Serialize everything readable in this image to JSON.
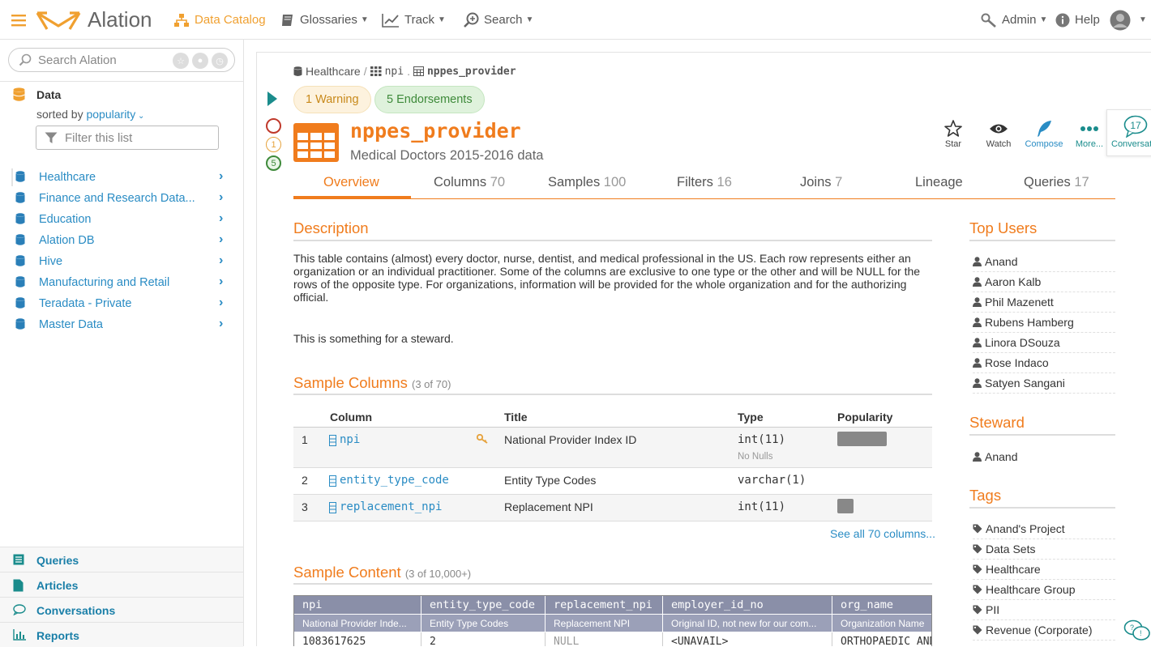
{
  "topbar": {
    "logo_text": "Alation",
    "nav": [
      {
        "label": "Data Catalog",
        "active": true
      },
      {
        "label": "Glossaries"
      },
      {
        "label": "Track"
      },
      {
        "label": "Search"
      }
    ],
    "admin_label": "Admin",
    "help_label": "Help"
  },
  "sidebar": {
    "search_placeholder": "Search Alation",
    "data_heading": "Data",
    "sorted_prefix": "sorted by",
    "sorted_value": "popularity",
    "filter_placeholder": "Filter this list",
    "sources": [
      {
        "label": "Healthcare"
      },
      {
        "label": "Finance and Research Data..."
      },
      {
        "label": "Education"
      },
      {
        "label": "Alation DB"
      },
      {
        "label": "Hive"
      },
      {
        "label": "Manufacturing and Retail"
      },
      {
        "label": "Teradata - Private"
      },
      {
        "label": "Master Data"
      }
    ],
    "bottom_nav": [
      {
        "label": "Queries"
      },
      {
        "label": "Articles"
      },
      {
        "label": "Conversations"
      },
      {
        "label": "Reports"
      }
    ]
  },
  "breadcrumb": {
    "source": "Healthcare",
    "schema": "npi",
    "table": "nppes_provider"
  },
  "badges": {
    "warning": "1 Warning",
    "endorsements": "5 Endorsements"
  },
  "status_counts": {
    "warning": "1",
    "endorsements": "5"
  },
  "object": {
    "title": "nppes_provider",
    "subtitle": "Medical Doctors 2015-2016 data"
  },
  "actions": {
    "star": "Star",
    "watch": "Watch",
    "compose": "Compose",
    "more": "More...",
    "conversation_label": "Conversation",
    "conversation_count": "17"
  },
  "tabs": [
    {
      "label": "Overview",
      "count": ""
    },
    {
      "label": "Columns",
      "count": "70"
    },
    {
      "label": "Samples",
      "count": "100"
    },
    {
      "label": "Filters",
      "count": "16"
    },
    {
      "label": "Joins",
      "count": "7"
    },
    {
      "label": "Lineage",
      "count": ""
    },
    {
      "label": "Queries",
      "count": "17"
    }
  ],
  "description": {
    "heading": "Description",
    "text": "This table contains (almost) every doctor, nurse, dentist, and medical professional in the US. Each row represents either an organization or an individual practitioner. Some of the columns are exclusive to one type or the other and will be NULL for the rows of the opposite type. For organizations, information will be provided for the whole organization and for the authorizing official.",
    "note": "This is something for a steward."
  },
  "sample_columns": {
    "heading": "Sample Columns",
    "count_label": "(3 of 70)",
    "headers": {
      "column": "Column",
      "title": "Title",
      "type": "Type",
      "popularity": "Popularity"
    },
    "rows": [
      {
        "num": "1",
        "name": "npi",
        "title": "National Provider Index ID",
        "type": "int(11)",
        "extra": "No Nulls",
        "popularity": 0.9
      },
      {
        "num": "2",
        "name": "entity_type_code",
        "title": "Entity Type Codes",
        "type": "varchar(1)",
        "extra": "",
        "popularity": 0
      },
      {
        "num": "3",
        "name": "replacement_npi",
        "title": "Replacement NPI",
        "type": "int(11)",
        "extra": "",
        "popularity": 0.3
      }
    ],
    "see_all": "See all 70 columns..."
  },
  "sample_content": {
    "heading": "Sample Content",
    "count_label": "(3 of 10,000+)",
    "columns": [
      "npi",
      "entity_type_code",
      "replacement_npi",
      "employer_id_no",
      "org_name"
    ],
    "titles": [
      "National Provider Inde...",
      "Entity Type Codes",
      "Replacement NPI",
      "Original ID, not new for our com...",
      "Organization Name"
    ],
    "first_row": [
      "1083617625",
      "2",
      "NULL",
      "<UNAVAIL>",
      "ORTHOPAEDIC AND"
    ]
  },
  "top_users": {
    "heading": "Top Users",
    "users": [
      "Anand",
      "Aaron Kalb",
      "Phil Mazenett",
      "Rubens Hamberg",
      "Linora DSouza",
      "Rose Indaco",
      "Satyen Sangani"
    ]
  },
  "steward": {
    "heading": "Steward",
    "name": "Anand"
  },
  "tags": {
    "heading": "Tags",
    "items": [
      "Anand's Project",
      "Data Sets",
      "Healthcare",
      "Healthcare Group",
      "PII",
      "Revenue (Corporate)"
    ]
  },
  "colors": {
    "brand": "#f07c1d",
    "link": "#2a8cc4",
    "teal": "#1a8c8c"
  }
}
